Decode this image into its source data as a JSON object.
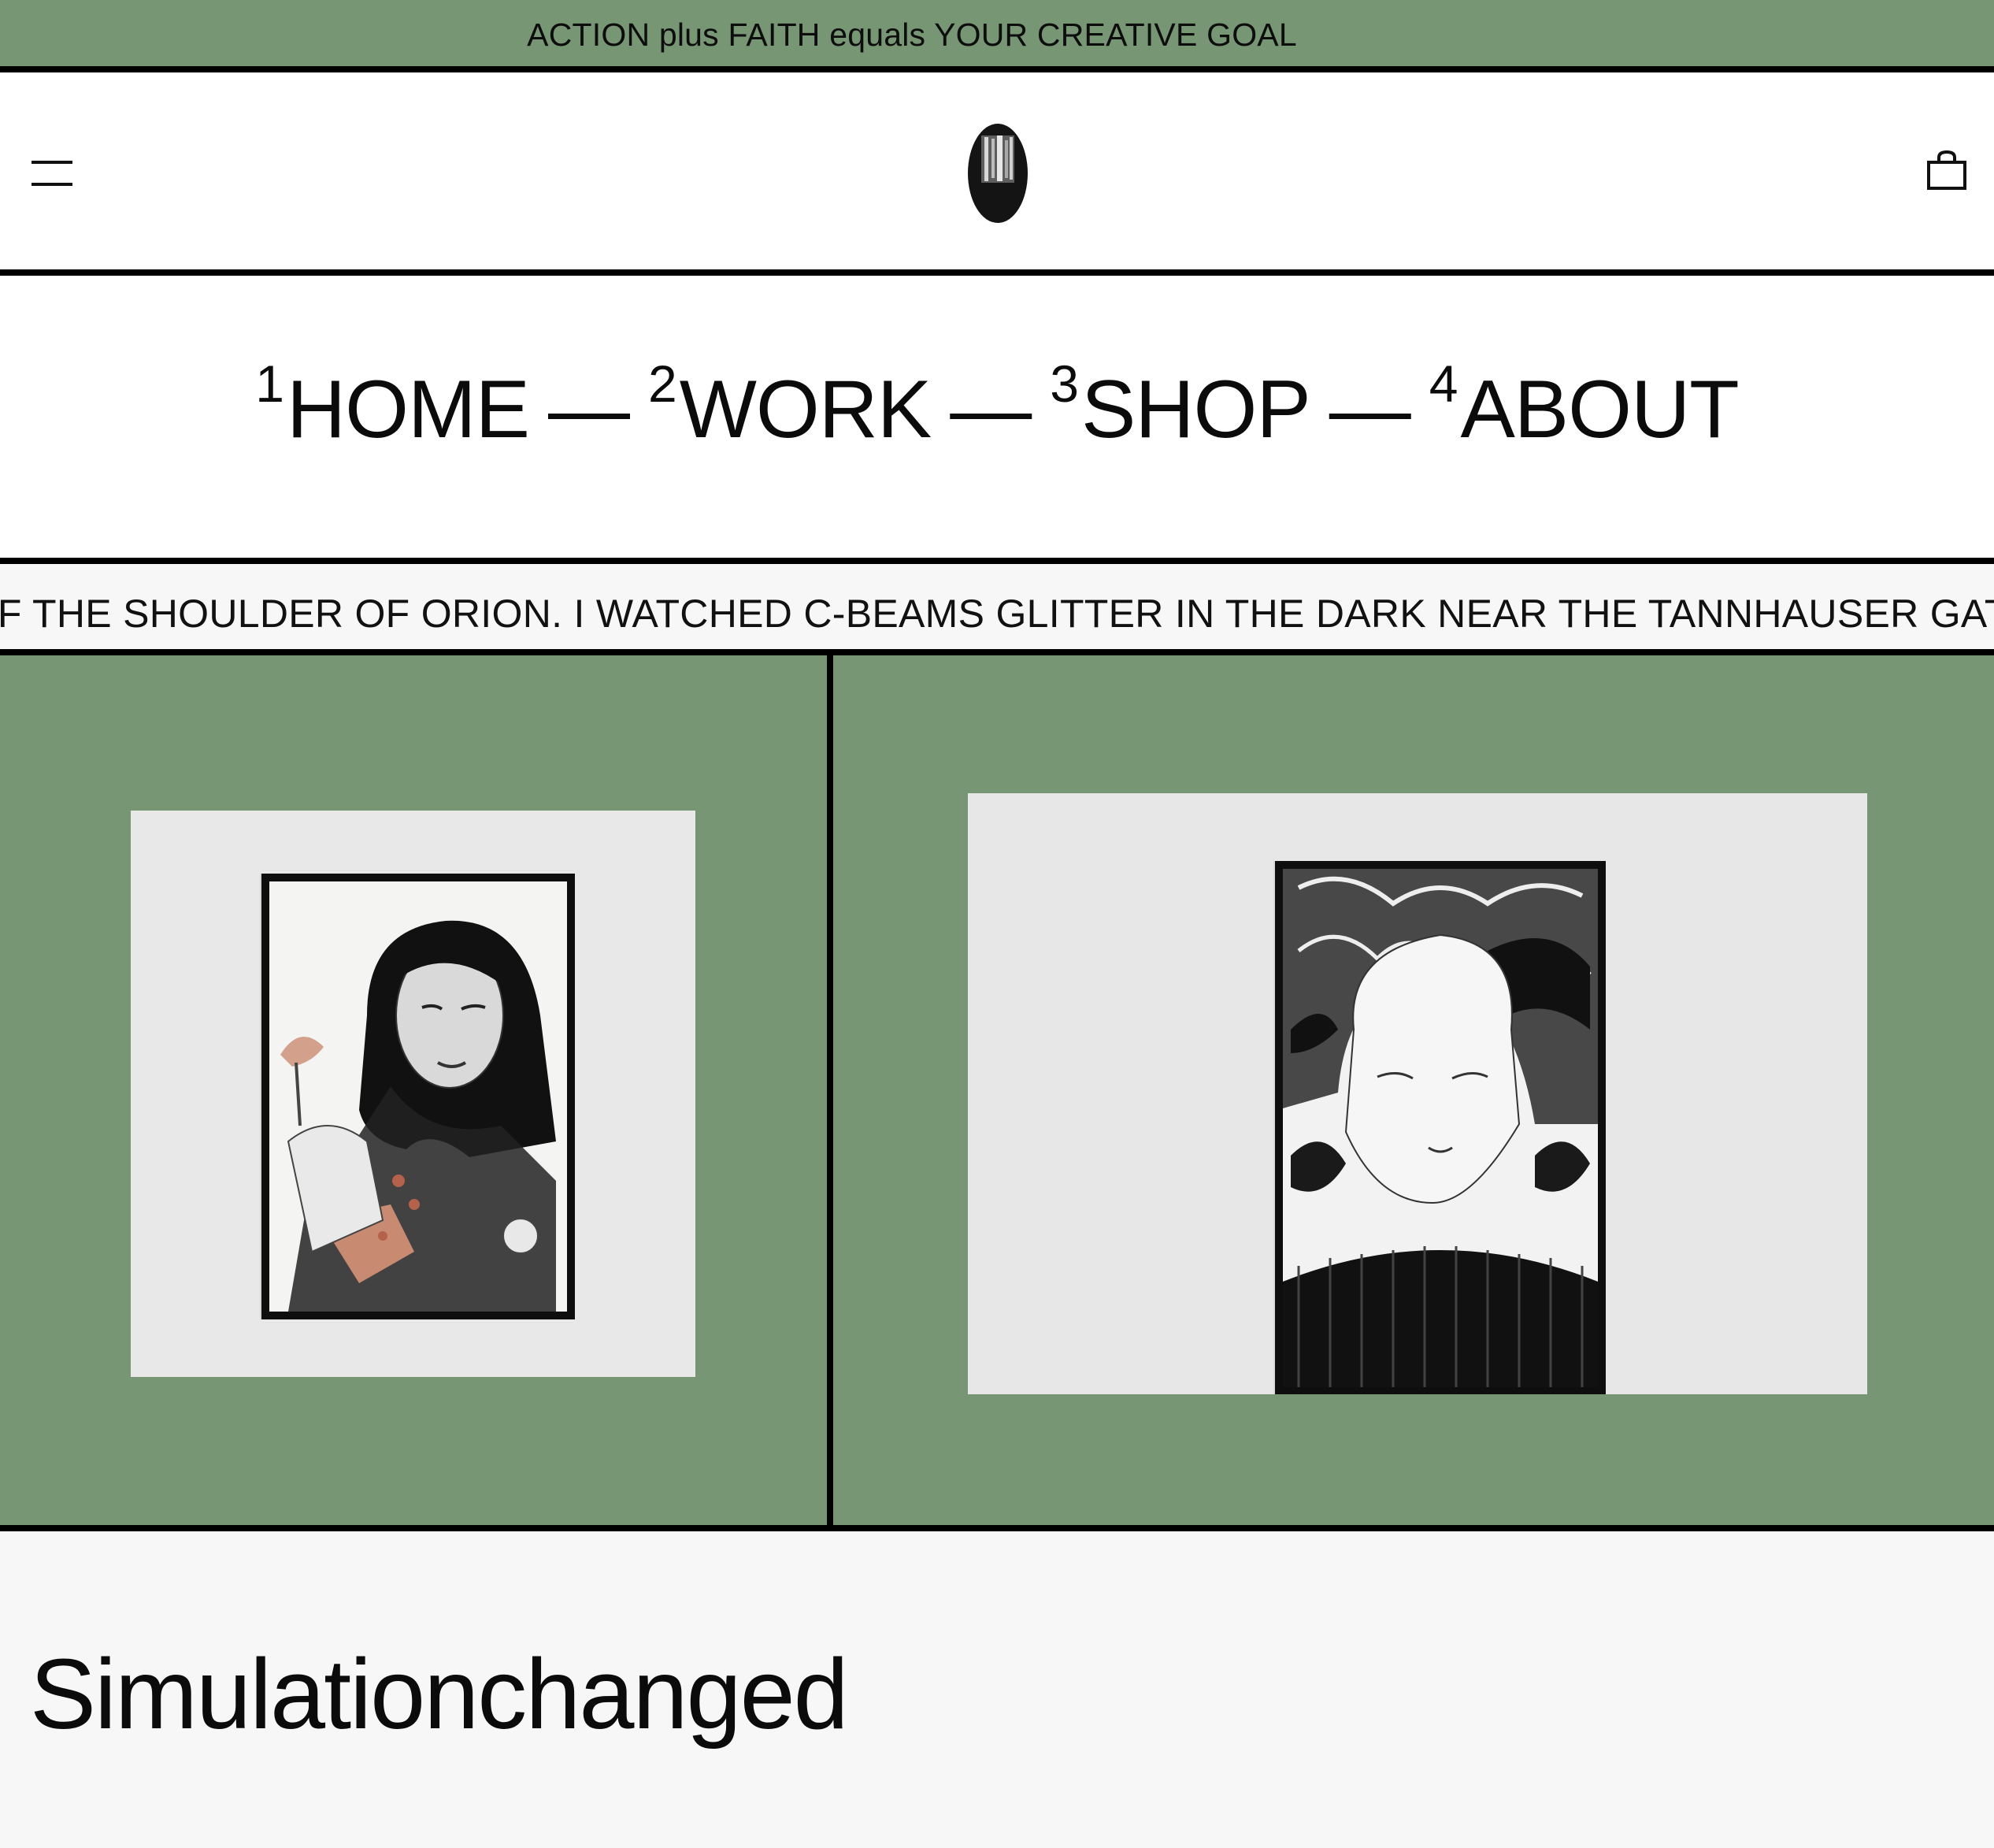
{
  "announcement": {
    "text": "ACTION plus FAITH equals YOUR CREATIVE GOAL"
  },
  "header": {
    "menu_icon": "hamburger-menu-icon",
    "logo_icon": "oval-logo-icon",
    "cart_icon": "shopping-bag-icon"
  },
  "nav": {
    "items": [
      {
        "number": "1",
        "label": "HOME"
      },
      {
        "number": "2",
        "label": "WORK"
      },
      {
        "number": "3",
        "label": "SHOP"
      },
      {
        "number": "4",
        "label": "ABOUT"
      }
    ],
    "separator": "—"
  },
  "ticker": {
    "text": "FF THE SHOULDER OF ORION. I WATCHED C-BEAMS GLITTER IN THE DARK NEAR THE TANNHAUSER GATE. A"
  },
  "gallery": {
    "background_color": "#779673",
    "items": [
      {
        "subject": "framed ink drawing of a woman with mushrooms"
      },
      {
        "subject": "framed ink drawing of a man's face with swirling lines"
      }
    ]
  },
  "product": {
    "title": "Simulationchanged"
  }
}
